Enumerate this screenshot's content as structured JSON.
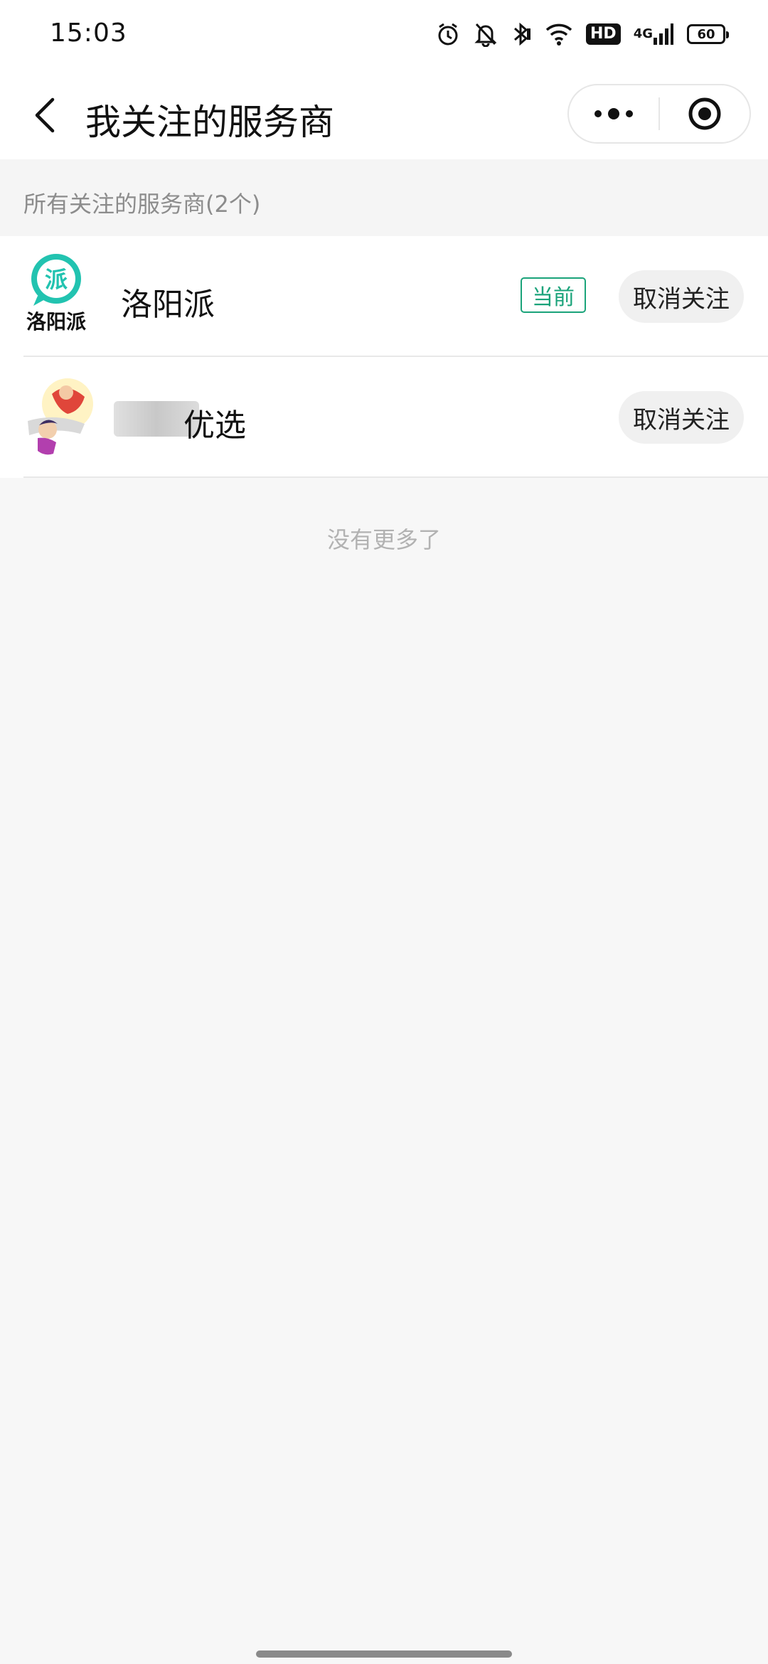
{
  "status_bar": {
    "time": "15:03",
    "network": "4G",
    "hd": "HD",
    "battery": "60",
    "icons": [
      "alarm-icon",
      "mute-bell-icon",
      "bluetooth-icon",
      "wifi-icon",
      "hd-icon",
      "signal-icon",
      "battery-icon"
    ]
  },
  "nav": {
    "title": "我关注的服务商",
    "back_icon": "back-chevron-icon",
    "more_icon": "more-dots-icon",
    "close_icon": "target-close-icon"
  },
  "section": {
    "title": "所有关注的服务商(2个)"
  },
  "providers": [
    {
      "name": "洛阳派",
      "logo_text": "洛阳派",
      "logo_mark": "派",
      "current_label": "当前",
      "unfollow_label": "取消关注",
      "accent": "#1aa37a"
    },
    {
      "name": "优选",
      "unfollow_label": "取消关注"
    }
  ],
  "footer": {
    "no_more": "没有更多了"
  }
}
